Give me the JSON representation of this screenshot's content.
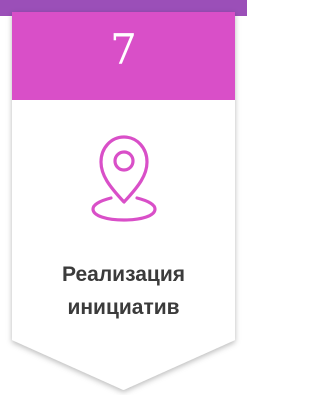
{
  "card": {
    "number": "7",
    "title_lines": [
      "Реализация",
      "инициатив"
    ],
    "icon": "location-pin-icon",
    "colors": {
      "accent": "#d94fc8",
      "accent_dark": "#9b4fb8",
      "body": "#ffffff",
      "text": "#3b3b3b"
    }
  }
}
